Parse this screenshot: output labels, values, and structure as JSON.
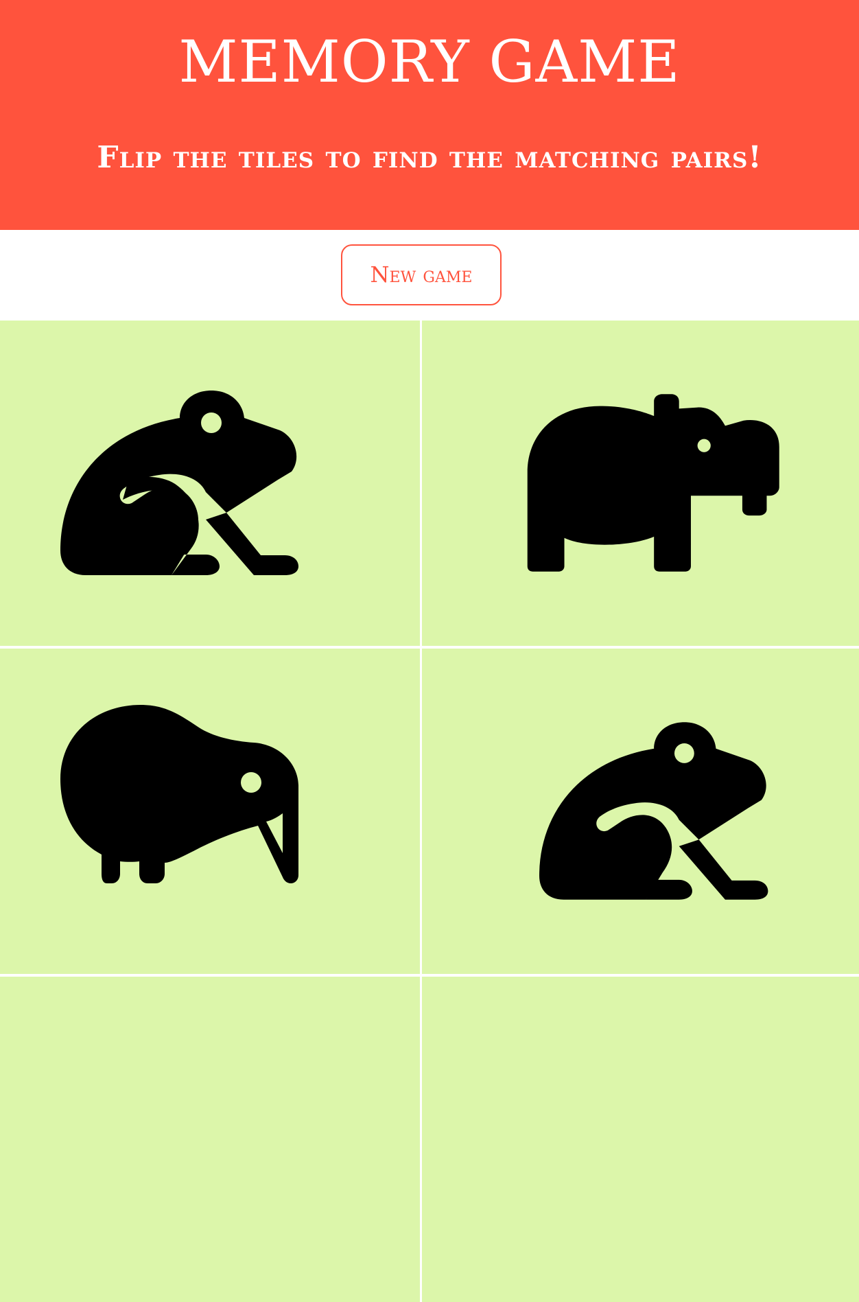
{
  "header": {
    "title": "MEMORY GAME",
    "subtitle": "Flip the tiles to find the matching pairs!"
  },
  "controls": {
    "new_game_label": "New game"
  },
  "colors": {
    "accent": "#ff533d",
    "tile_background": "#dcf6aa",
    "icon": "#000000"
  },
  "board": {
    "tiles": [
      {
        "icon": "frog-icon",
        "face_up": true
      },
      {
        "icon": "hippo-icon",
        "face_up": true
      },
      {
        "icon": "kiwi-bird-icon",
        "face_up": true
      },
      {
        "icon": "frog-icon",
        "face_up": true
      }
    ]
  }
}
